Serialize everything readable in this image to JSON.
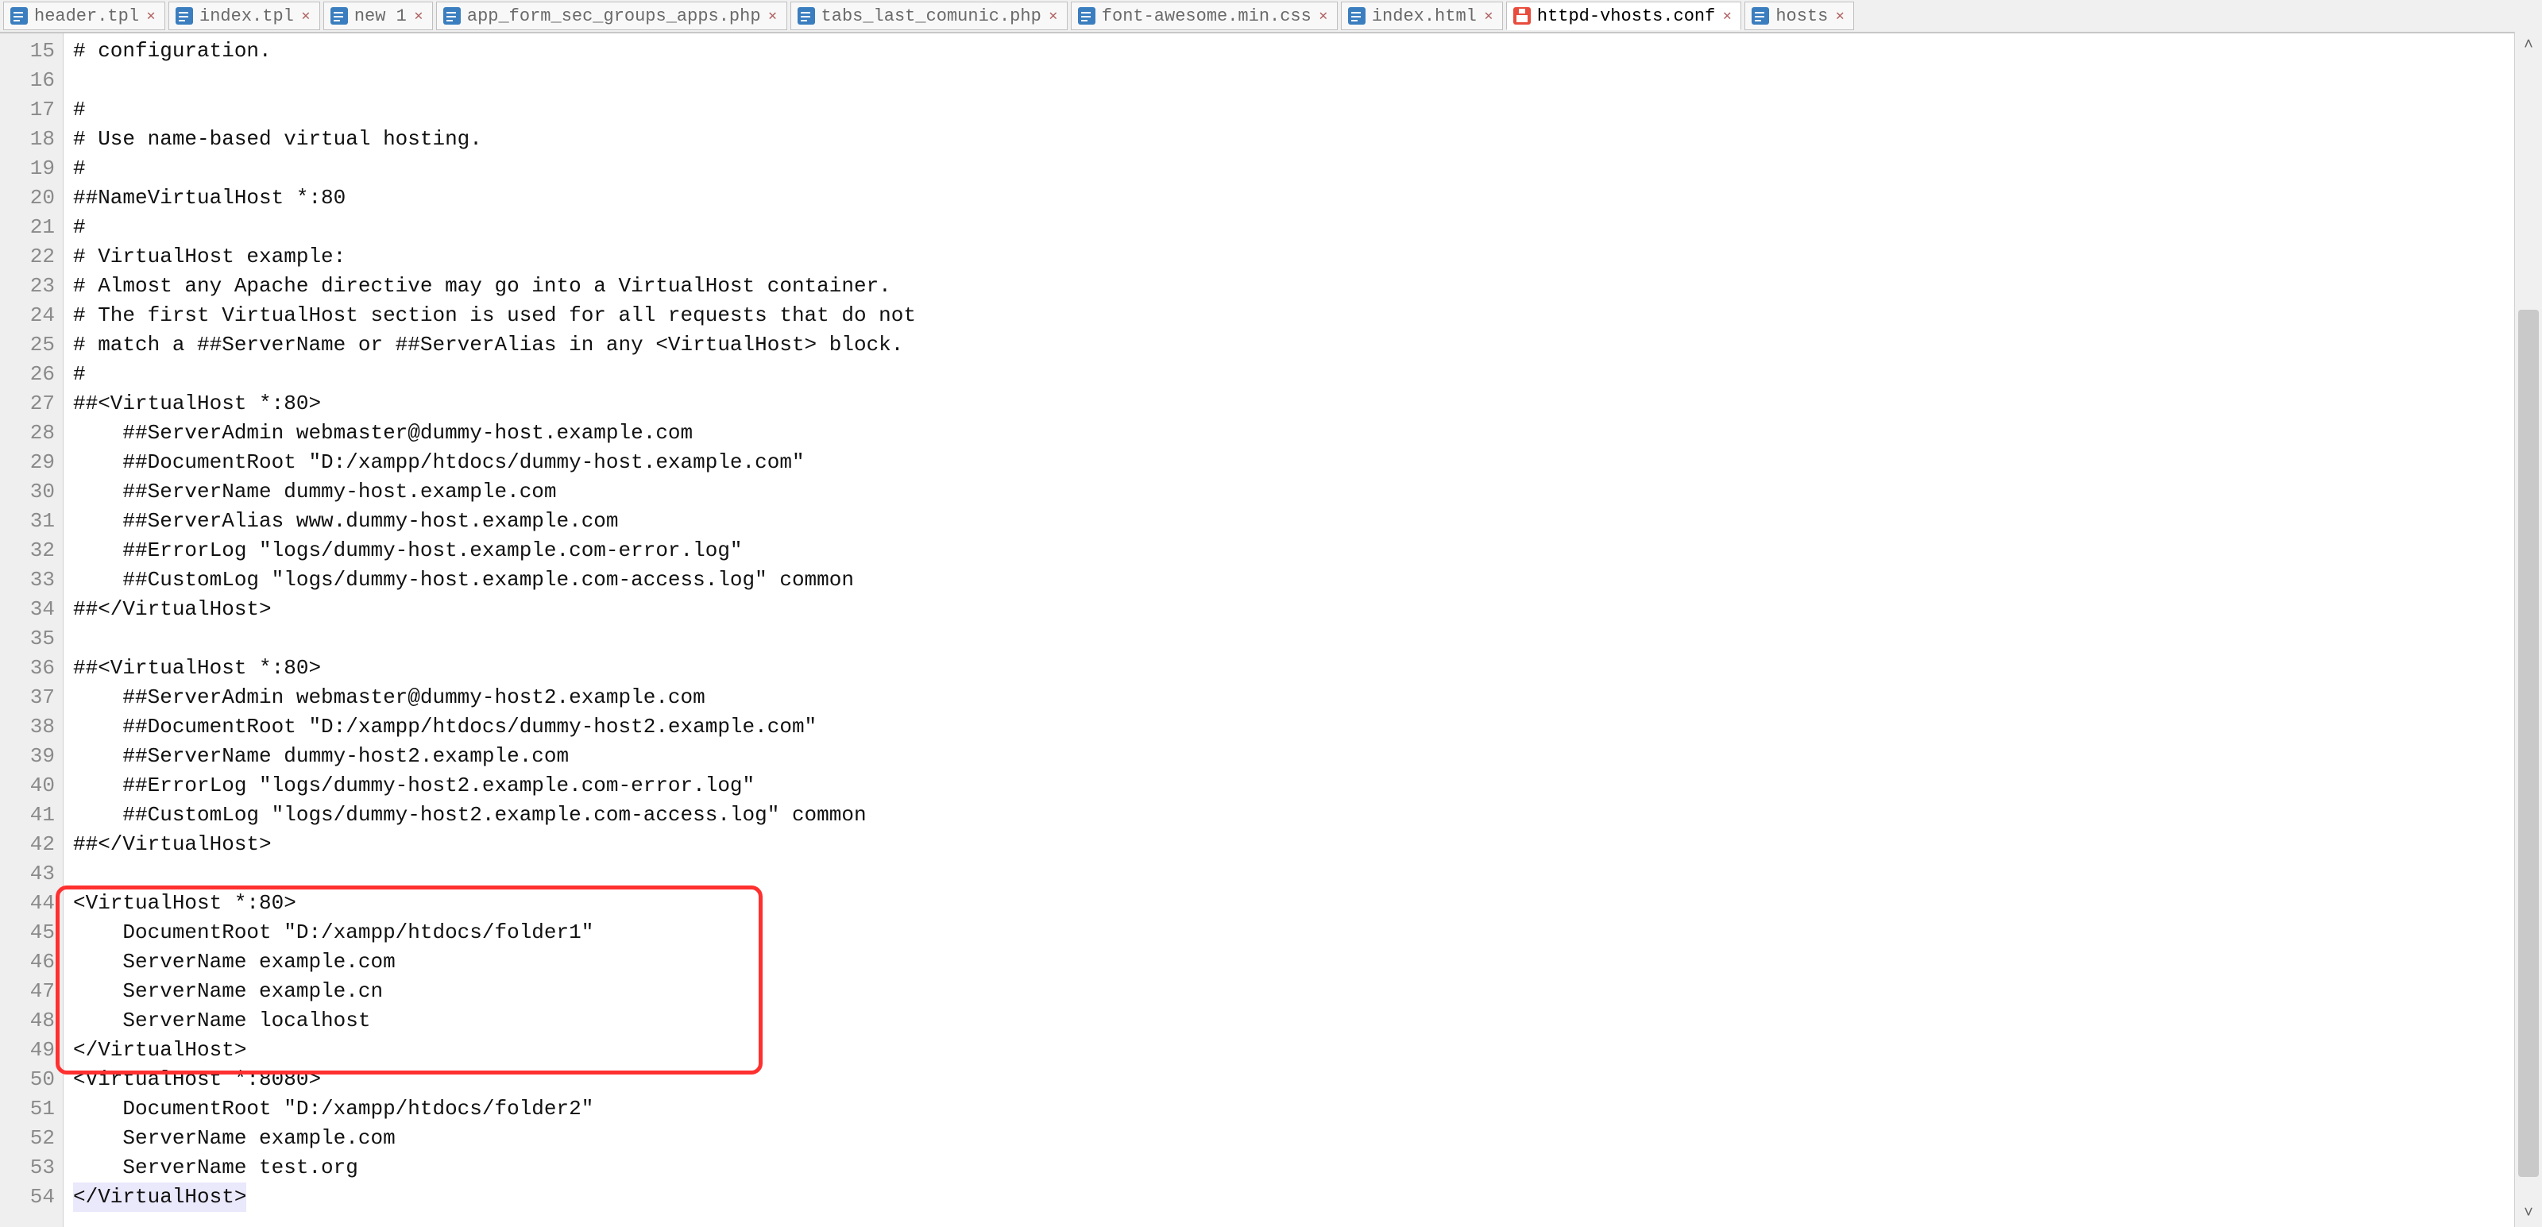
{
  "tabs": [
    {
      "label": "header.tpl",
      "icon": "tpl",
      "active": false
    },
    {
      "label": "index.tpl",
      "icon": "tpl",
      "active": false
    },
    {
      "label": "new 1",
      "icon": "tpl",
      "active": false
    },
    {
      "label": "app_form_sec_groups_apps.php",
      "icon": "php",
      "active": false
    },
    {
      "label": "tabs_last_comunic.php",
      "icon": "php",
      "active": false
    },
    {
      "label": "font-awesome.min.css",
      "icon": "css",
      "active": false
    },
    {
      "label": "index.html",
      "icon": "html",
      "active": false
    },
    {
      "label": "httpd-vhosts.conf",
      "icon": "conf",
      "active": true
    },
    {
      "label": "hosts",
      "icon": "txt",
      "active": false
    }
  ],
  "first_line_no": 15,
  "code_lines": [
    "# configuration.",
    "",
    "#",
    "# Use name-based virtual hosting.",
    "#",
    "##NameVirtualHost *:80",
    "#",
    "# VirtualHost example:",
    "# Almost any Apache directive may go into a VirtualHost container.",
    "# The first VirtualHost section is used for all requests that do not",
    "# match a ##ServerName or ##ServerAlias in any <VirtualHost> block.",
    "#",
    "##<VirtualHost *:80>",
    "    ##ServerAdmin webmaster@dummy-host.example.com",
    "    ##DocumentRoot \"D:/xampp/htdocs/dummy-host.example.com\"",
    "    ##ServerName dummy-host.example.com",
    "    ##ServerAlias www.dummy-host.example.com",
    "    ##ErrorLog \"logs/dummy-host.example.com-error.log\"",
    "    ##CustomLog \"logs/dummy-host.example.com-access.log\" common",
    "##</VirtualHost>",
    "",
    "##<VirtualHost *:80>",
    "    ##ServerAdmin webmaster@dummy-host2.example.com",
    "    ##DocumentRoot \"D:/xampp/htdocs/dummy-host2.example.com\"",
    "    ##ServerName dummy-host2.example.com",
    "    ##ErrorLog \"logs/dummy-host2.example.com-error.log\"",
    "    ##CustomLog \"logs/dummy-host2.example.com-access.log\" common",
    "##</VirtualHost>",
    "",
    "<VirtualHost *:80>",
    "    DocumentRoot \"D:/xampp/htdocs/folder1\"",
    "    ServerName example.com",
    "    ServerName example.cn",
    "    ServerName localhost",
    "</VirtualHost>",
    "<VirtualHost *:8080>",
    "    DocumentRoot \"D:/xampp/htdocs/folder2\"",
    "    ServerName example.com",
    "    ServerName test.org",
    "</VirtualHost>"
  ],
  "current_line_index": 39,
  "redbox": {
    "start_index": 29,
    "end_index": 34
  },
  "scroll": {
    "thumb_top_pct": 22,
    "thumb_height_pct": 76
  },
  "arrows": {
    "up": "˄",
    "down": "˅"
  }
}
